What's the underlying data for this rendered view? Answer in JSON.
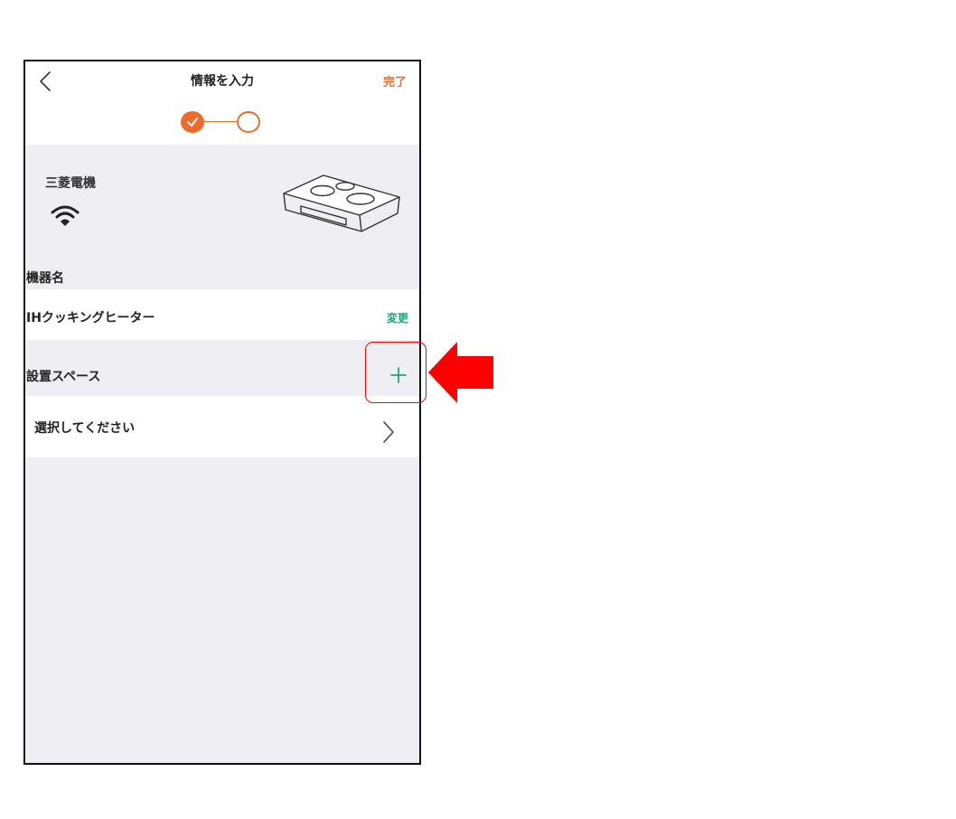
{
  "header": {
    "back_icon": "chevron-left-icon",
    "title": "情報を入力",
    "done_label": "完了"
  },
  "steps": {
    "completed_icon": "check-circle-icon",
    "pending_icon": "circle-outline-icon",
    "current_step": 2,
    "total_steps": 2
  },
  "device": {
    "maker": "三菱電機",
    "connection_icon": "wifi-icon",
    "image_icon": "ih-cooktop-icon"
  },
  "device_name": {
    "section_label": "機器名",
    "value": "IHクッキングヒーター",
    "change_label": "変更"
  },
  "install_space": {
    "section_label": "設置スペース",
    "add_icon": "plus-icon",
    "select_placeholder": "選択してください",
    "chevron_icon": "chevron-right-icon"
  },
  "annotation": {
    "highlight_icon": "highlight-box",
    "arrow_icon": "red-arrow-left-icon"
  },
  "colors": {
    "accent_orange": "#ee6b2c",
    "accent_green": "#23a374",
    "background_gray": "#efeef3",
    "annotation_red": "#ff0000"
  }
}
